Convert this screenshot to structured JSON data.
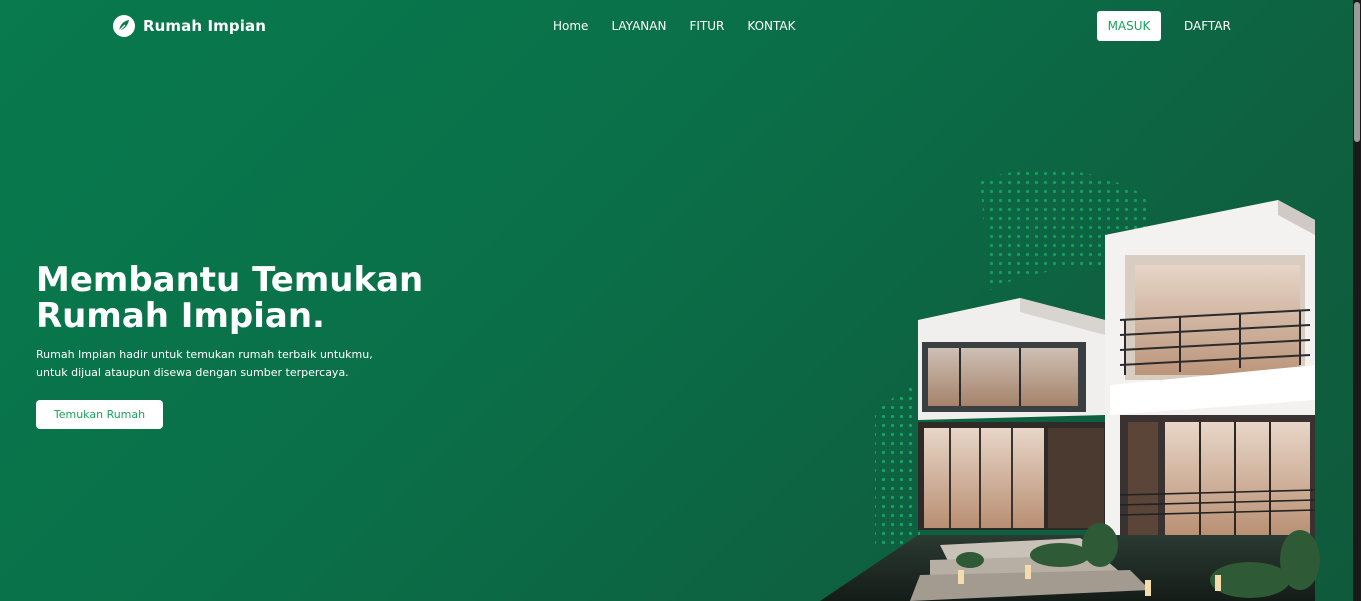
{
  "brand": {
    "name": "Rumah Impian",
    "icon": "leaf-logo-icon"
  },
  "nav": {
    "items": [
      {
        "label": "Home"
      },
      {
        "label": "LAYANAN"
      },
      {
        "label": "FITUR"
      },
      {
        "label": "KONTAK"
      }
    ]
  },
  "auth": {
    "login_label": "MASUK",
    "register_label": "DAFTAR"
  },
  "hero": {
    "title": "Membantu Temukan Rumah Impian.",
    "description": "Rumah Impian hadir untuk temukan rumah terbaik untukmu, untuk dijual ataupun disewa dengan sumber terpercaya.",
    "cta_label": "Temukan Rumah"
  },
  "colors": {
    "background": "#087a4d",
    "accent": "#18a35d",
    "button_bg": "#ffffff",
    "text": "#ffffff"
  }
}
